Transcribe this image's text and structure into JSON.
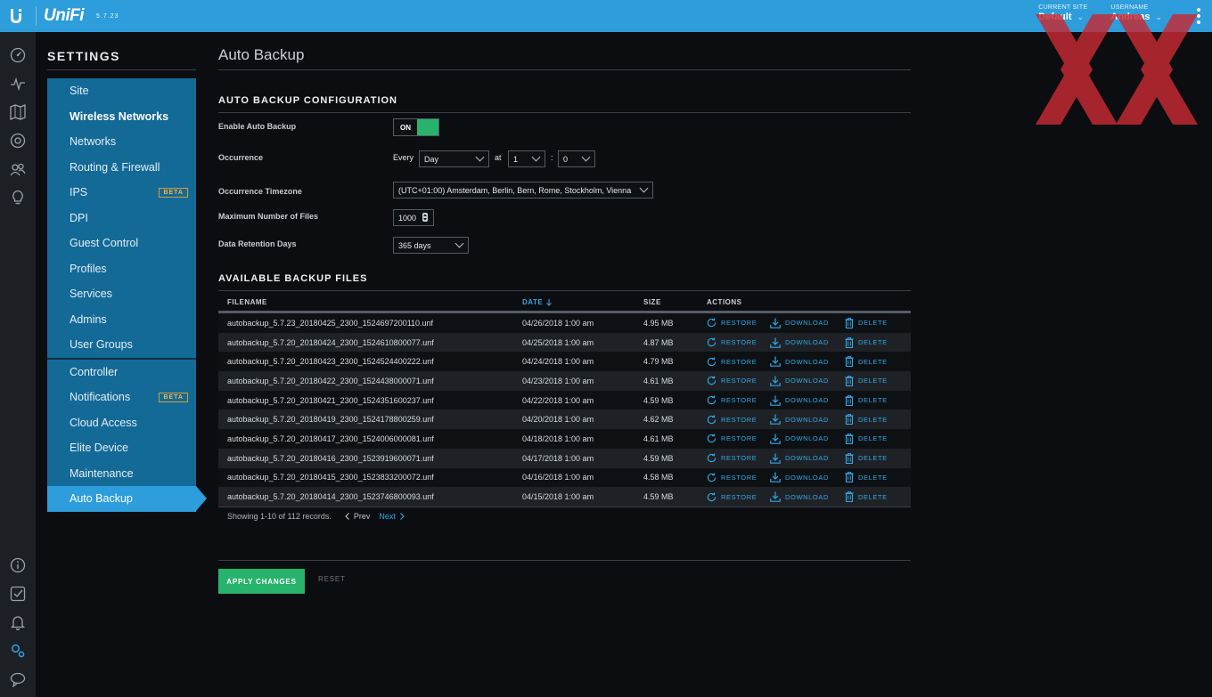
{
  "topbar": {
    "brand": "UniFi",
    "version": "5.7.23",
    "current_site_label": "CURRENT SITE",
    "current_site_value": "Default",
    "username_label": "USERNAME",
    "username_value": "Andreas"
  },
  "rail_icons": [
    "dashboard-icon",
    "statistics-icon",
    "map-icon",
    "devices-icon",
    "clients-icon",
    "insights-icon",
    "info-icon",
    "tasks-icon",
    "alerts-icon",
    "settings-icon",
    "chat-icon"
  ],
  "settings": {
    "title": "SETTINGS",
    "groups": [
      [
        {
          "label": "Site",
          "badge": ""
        },
        {
          "label": "Wireless Networks",
          "badge": ""
        },
        {
          "label": "Networks",
          "badge": ""
        },
        {
          "label": "Routing & Firewall",
          "badge": ""
        },
        {
          "label": "IPS",
          "badge": "BETA"
        },
        {
          "label": "DPI",
          "badge": ""
        },
        {
          "label": "Guest Control",
          "badge": ""
        },
        {
          "label": "Profiles",
          "badge": ""
        },
        {
          "label": "Services",
          "badge": ""
        },
        {
          "label": "Admins",
          "badge": ""
        },
        {
          "label": "User Groups",
          "badge": ""
        }
      ],
      [
        {
          "label": "Controller",
          "badge": ""
        },
        {
          "label": "Notifications",
          "badge": "BETA"
        },
        {
          "label": "Cloud Access",
          "badge": ""
        },
        {
          "label": "Elite Device",
          "badge": ""
        },
        {
          "label": "Maintenance",
          "badge": ""
        },
        {
          "label": "Auto Backup",
          "badge": ""
        }
      ]
    ],
    "active": "Auto Backup",
    "highlighted": "Wireless Networks"
  },
  "page": {
    "title": "Auto Backup",
    "config_title": "AUTO BACKUP CONFIGURATION",
    "enable_label": "Enable Auto Backup",
    "toggle_state": "ON",
    "occurrence_label": "Occurrence",
    "every_text": "Every",
    "occurrence_value": "Day",
    "at_text": "at",
    "hour_value": "1",
    "colon_text": ":",
    "minute_value": "0",
    "timezone_label": "Occurrence Timezone",
    "timezone_value": "(UTC+01:00) Amsterdam, Berlin, Bern, Rome, Stockholm, Vienna",
    "max_files_label": "Maximum Number of Files",
    "max_files_value": "1000",
    "retention_label": "Data Retention Days",
    "retention_value": "365 days",
    "files_title": "AVAILABLE BACKUP FILES"
  },
  "table": {
    "headers": {
      "filename": "FILENAME",
      "date": "DATE",
      "size": "SIZE",
      "actions": "ACTIONS"
    },
    "actions": {
      "restore": "RESTORE",
      "download": "DOWNLOAD",
      "delete": "DELETE"
    },
    "rows": [
      {
        "filename": "autobackup_5.7.23_20180425_2300_1524697200110.unf",
        "date": "04/26/2018 1:00 am",
        "size": "4.95 MB"
      },
      {
        "filename": "autobackup_5.7.20_20180424_2300_1524610800077.unf",
        "date": "04/25/2018 1:00 am",
        "size": "4.87 MB"
      },
      {
        "filename": "autobackup_5.7.20_20180423_2300_1524524400222.unf",
        "date": "04/24/2018 1:00 am",
        "size": "4.79 MB"
      },
      {
        "filename": "autobackup_5.7.20_20180422_2300_1524438000071.unf",
        "date": "04/23/2018 1:00 am",
        "size": "4.61 MB"
      },
      {
        "filename": "autobackup_5.7.20_20180421_2300_1524351600237.unf",
        "date": "04/22/2018 1:00 am",
        "size": "4.59 MB"
      },
      {
        "filename": "autobackup_5.7.20_20180419_2300_1524178800259.unf",
        "date": "04/20/2018 1:00 am",
        "size": "4.62 MB"
      },
      {
        "filename": "autobackup_5.7.20_20180417_2300_1524006000081.unf",
        "date": "04/18/2018 1:00 am",
        "size": "4.61 MB"
      },
      {
        "filename": "autobackup_5.7.20_20180416_2300_1523919600071.unf",
        "date": "04/17/2018 1:00 am",
        "size": "4.59 MB"
      },
      {
        "filename": "autobackup_5.7.20_20180415_2300_1523833200072.unf",
        "date": "04/16/2018 1:00 am",
        "size": "4.58 MB"
      },
      {
        "filename": "autobackup_5.7.20_20180414_2300_1523746800093.unf",
        "date": "04/15/2018 1:00 am",
        "size": "4.59 MB"
      }
    ],
    "showing_text": "Showing 1-10 of 112 records.",
    "prev_label": "Prev",
    "next_label": "Next"
  },
  "buttons": {
    "apply": "APPLY CHANGES",
    "reset": "RESET"
  },
  "colors": {
    "accent": "#2d9ddb",
    "link": "#34a7e6",
    "success": "#27b36b",
    "badge": "#d79b2d"
  }
}
